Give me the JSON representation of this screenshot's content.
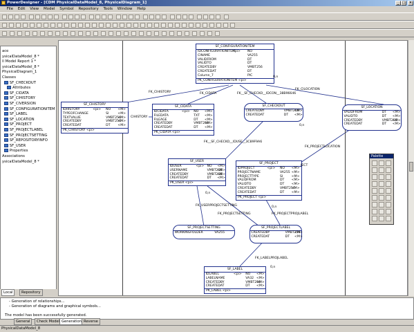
{
  "window": {
    "title": "PowerDesigner - [CDM PhysicalDataModel_8, PhysicalDiagram_1]"
  },
  "menu": [
    "File",
    "Edit",
    "View",
    "Model",
    "Symbol",
    "Repository",
    "Tools",
    "Window",
    "Help"
  ],
  "browser": {
    "items": [
      {
        "label": "ace",
        "indent": 0
      },
      {
        "label": "ysicalDataModel_8 *",
        "indent": 0
      },
      {
        "label": "ll Model Report 1 *",
        "indent": 0
      },
      {
        "label": "ysicalDataModel_8 *",
        "indent": 0
      },
      {
        "label": "PhysicalDiagram_1",
        "indent": 0
      },
      {
        "label": "Classes",
        "indent": 0
      },
      {
        "label": "SF_CHECKOUT",
        "indent": 2,
        "icon": true
      },
      {
        "label": "Attributes",
        "indent": 5,
        "icon": true
      },
      {
        "label": "SF_CIDATA",
        "indent": 2,
        "icon": true
      },
      {
        "label": "SF_CIHISTORY",
        "indent": 2,
        "icon": true
      },
      {
        "label": "SF_CIVERSION",
        "indent": 2,
        "icon": true
      },
      {
        "label": "SF_CONFIGURATIONITEM",
        "indent": 2,
        "icon": true
      },
      {
        "label": "SF_LABEL",
        "indent": 2,
        "icon": true
      },
      {
        "label": "SF_LOCATION",
        "indent": 2,
        "icon": true
      },
      {
        "label": "SF_PROJECT",
        "indent": 2,
        "icon": true
      },
      {
        "label": "SF_PROJECTLABEL",
        "indent": 2,
        "icon": true
      },
      {
        "label": "SF_PROJECTSETTING",
        "indent": 2,
        "icon": true
      },
      {
        "label": "SF_REPOSITORYINFO",
        "indent": 2,
        "icon": true
      },
      {
        "label": "SF_USER",
        "indent": 2,
        "icon": true
      },
      {
        "label": "Properties",
        "indent": 2,
        "icon": true
      },
      {
        "label": "Associations",
        "indent": 0
      },
      {
        "label": "ysicalDataModel_8 *",
        "indent": 0
      }
    ],
    "tabs": [
      "Local",
      "Repository"
    ]
  },
  "entities": [
    {
      "id": "cfg",
      "name": "SF_CONFIGURATIONITEM",
      "rows": [
        [
          "IDCONFIGURATIONITEM",
          "<pi>",
          "NO",
          ""
        ],
        [
          "CINAME",
          "",
          "VA255",
          ""
        ],
        [
          "VALIDFROM",
          "",
          "DT",
          ""
        ],
        [
          "VALIDTO",
          "",
          "DT",
          ""
        ],
        [
          "CREATEDBY",
          "",
          "VMBT256",
          ""
        ],
        [
          "CREATEDAT",
          "",
          "DT",
          ""
        ],
        [
          "Column_7",
          "",
          "PIC",
          ""
        ]
      ],
      "footer": "PK_CONFIGURATIONITEM  <pi>"
    },
    {
      "id": "hist",
      "name": "SF_CIHISTORY",
      "rows": [
        [
          "IDHISTORY",
          "<pi>",
          "NO",
          "<M>"
        ],
        [
          "TYPEOFCHANGE",
          "",
          "SI",
          "<M>"
        ],
        [
          "TEXTVALUE",
          "",
          "VMBT256",
          "<M>"
        ],
        [
          "CREATEDBY",
          "",
          "VMBT256",
          "<M>"
        ],
        [
          "CREATEDAT",
          "",
          "DT",
          "<M>"
        ]
      ],
      "footer": "PK_CIHISTORY  <pi>"
    },
    {
      "id": "cidata",
      "name": "SF_CIDATA",
      "rows": [
        [
          "IDCIDATA",
          "<pi>",
          "NO",
          "<M>"
        ],
        [
          "FILEDATA",
          "",
          "TXT",
          "<M>"
        ],
        [
          "FILEAGE",
          "",
          "DT",
          "<M>"
        ],
        [
          "CREATEDBY",
          "",
          "VMBT256",
          "<M>"
        ],
        [
          "CREATEDAT",
          "",
          "DT",
          "<M>"
        ]
      ],
      "footer": "PK_CIDATA  <pi>"
    },
    {
      "id": "checkout",
      "name": "SF_CHECKOUT",
      "rows": [
        [
          "CREATEDBY",
          "",
          "VMBT256",
          "<M>"
        ],
        [
          "CREATEDAT",
          "",
          "DT",
          "<M>"
        ]
      ],
      "footer": ""
    },
    {
      "id": "location",
      "name": "SF_LOCATION",
      "rows": [
        [
          "VALIDFROM",
          "",
          "DT",
          "<M>"
        ],
        [
          "VALIDTO",
          "",
          "DT",
          "<M>"
        ],
        [
          "CREATEDBY",
          "",
          "VMBT256",
          "<M>"
        ],
        [
          "CREATEDAT",
          "",
          "DT",
          "<M>"
        ]
      ],
      "footer": ""
    },
    {
      "id": "user",
      "name": "SF_USER",
      "rows": [
        [
          "IDUSER",
          "<pi>",
          "NO",
          "<M>"
        ],
        [
          "USERNAME",
          "",
          "VMBT256",
          "<M>"
        ],
        [
          "CREATEDBY",
          "",
          "VMBT256",
          "<M>"
        ],
        [
          "CREATEDAT",
          "",
          "DT",
          "<M>"
        ]
      ],
      "footer": "PK_USER  <pi>"
    },
    {
      "id": "project",
      "name": "SF_PROJECT",
      "rows": [
        [
          "IDPROJECT",
          "<pi>",
          "NO",
          "<M>"
        ],
        [
          "PROJECTNAME",
          "",
          "VA255",
          "<M>"
        ],
        [
          "PROJECTTYPE",
          "",
          "SI",
          "<M>"
        ],
        [
          "VALIDFROM",
          "",
          "DT",
          "<M>"
        ],
        [
          "VALIDTO",
          "",
          "DT",
          "<M>"
        ],
        [
          "CREATEDBY",
          "",
          "VMBT256",
          "<M>"
        ],
        [
          "CREATEDAT",
          "",
          "DT",
          "<M>"
        ]
      ],
      "footer": "PK_PROJECT  <pi>"
    },
    {
      "id": "projsetting",
      "name": "SF_PROJECTSETTING",
      "rows": [
        [
          "WORKINGFOLDER",
          "",
          "VA255",
          ""
        ]
      ],
      "footer": ""
    },
    {
      "id": "projlabel",
      "name": "SF_PROJECTLABEL",
      "rows": [
        [
          "CREATEDBY",
          "",
          "VMBT256",
          "<M>"
        ],
        [
          "CREATEDAT",
          "",
          "DT",
          "<M>"
        ]
      ],
      "footer": ""
    },
    {
      "id": "label",
      "name": "SF_LABEL",
      "rows": [
        [
          "IDLABEL",
          "<pi>",
          "NO",
          "<M>"
        ],
        [
          "LABELNAME",
          "",
          "VA32",
          "<M>"
        ],
        [
          "CREATEDBY",
          "",
          "VMBT256",
          "<M>"
        ],
        [
          "CREATEDAT",
          "",
          "DT",
          "<M>"
        ]
      ],
      "footer": "PK_LABEL  <pi>"
    }
  ],
  "relations": [
    {
      "label": "FK_CIHISTORY"
    },
    {
      "label": "FK_CIDATA"
    },
    {
      "label": "FK__SF_CHECKO__IDCON__38B96646"
    },
    {
      "label": "FK_CILOCATION"
    },
    {
      "label": "0,n"
    },
    {
      "label": "0,n"
    },
    {
      "label": "FK__SF_CHECKO__IDUSE__3C89F9A6"
    },
    {
      "label": "FK_PROJECTLOCATION"
    },
    {
      "label": "JECT"
    },
    {
      "label": "FK_USERPROJECTSETTING"
    },
    {
      "label": "FK_PROJECTSETTING"
    },
    {
      "label": "FK_PROJECTPROJLABEL"
    },
    {
      "label": "0,n"
    },
    {
      "label": "0,n"
    },
    {
      "label": "FK_LABELPROJLABEL"
    },
    {
      "label": "0,n"
    },
    {
      "label": "CIHISTORY"
    }
  ],
  "palette": {
    "title": "Palette"
  },
  "output": {
    "lines": [
      "- Generation of relationships...",
      "- Generation of diagrams and graphical symbols...",
      "",
      "The model has been successfully generated."
    ],
    "tabs": [
      "General",
      "Check Model",
      "Generation",
      "Reverse"
    ]
  },
  "status": {
    "text": "PhysicalDataModel_8"
  }
}
